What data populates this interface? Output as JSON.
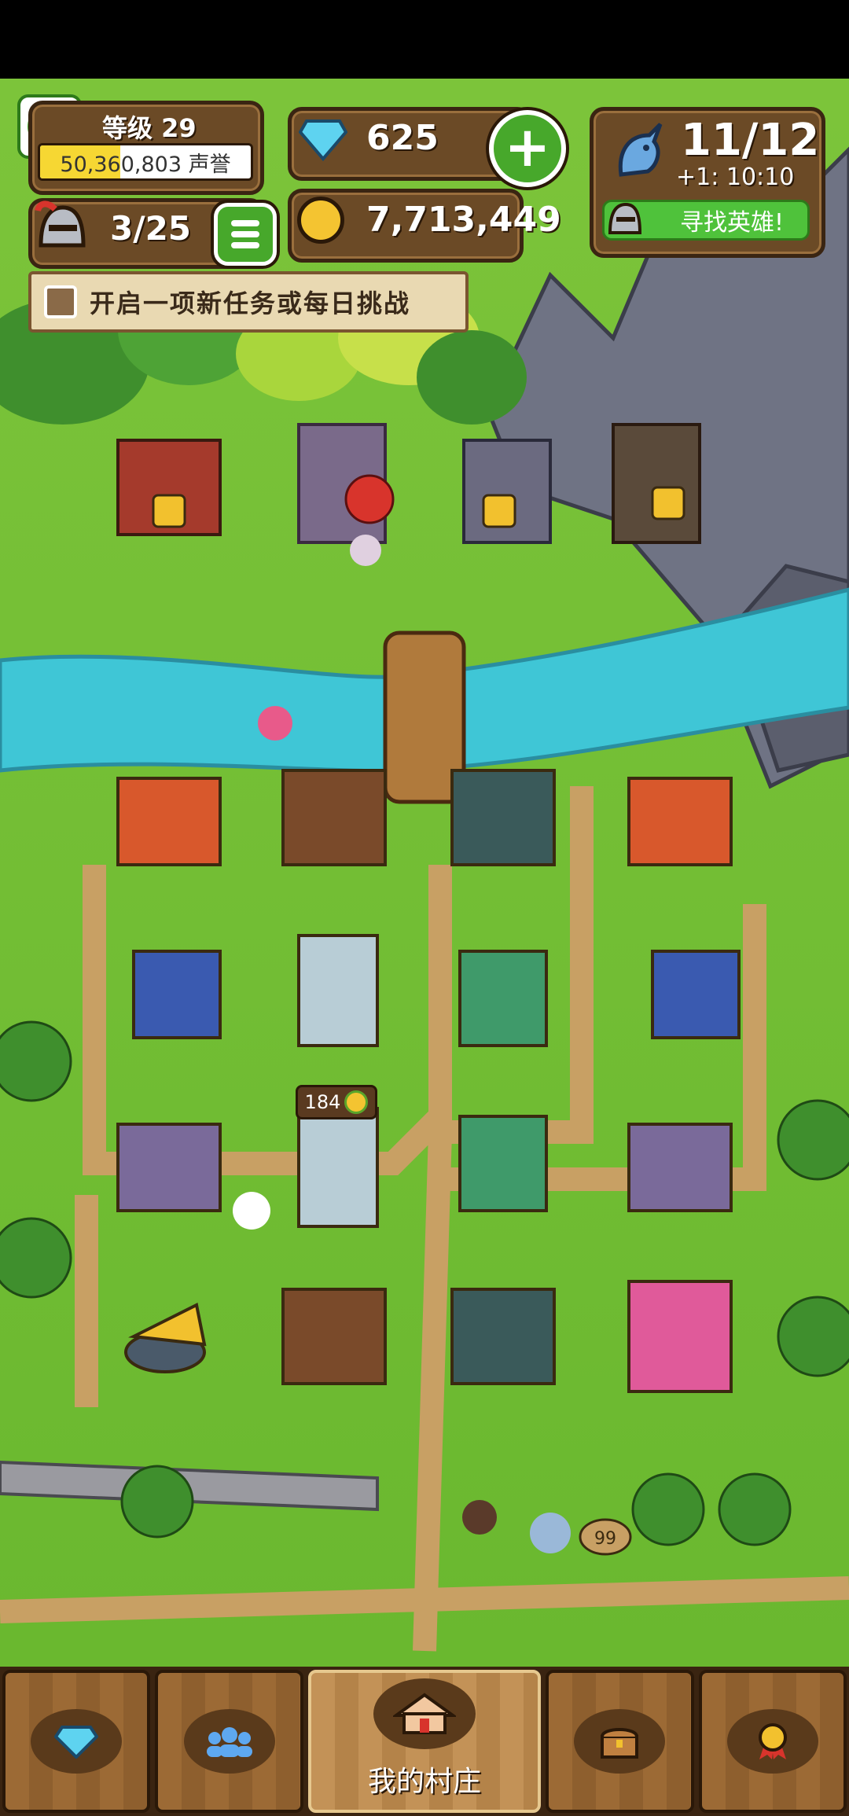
{
  "hud": {
    "level_label": "等级 29",
    "honor_text": "50,360,803 声誉",
    "honor_progress": 0.38,
    "gems": "625",
    "gold": "7,713,449",
    "heroes_count": "3/25",
    "roster": "11/12",
    "roster_timer": "+1: 10:10",
    "find_hero_label": "寻找英雄!"
  },
  "quest_banner": {
    "text": "开启一项新任务或每日挑战"
  },
  "map": {
    "price_tag": "184",
    "stack_count": "99"
  },
  "bottom_nav": {
    "tabs": [
      {
        "icon": "gem-icon",
        "label": ""
      },
      {
        "icon": "heroes-icon",
        "label": ""
      },
      {
        "icon": "village-icon",
        "label": "我的村庄"
      },
      {
        "icon": "chest-icon",
        "label": ""
      },
      {
        "icon": "medal-icon",
        "label": ""
      }
    ]
  },
  "colors": {
    "grass": "#7cc43a",
    "river": "#3fc6d6",
    "path": "#c8a064",
    "wood_panel": "#6b4a26",
    "green_button": "#47a82b"
  }
}
